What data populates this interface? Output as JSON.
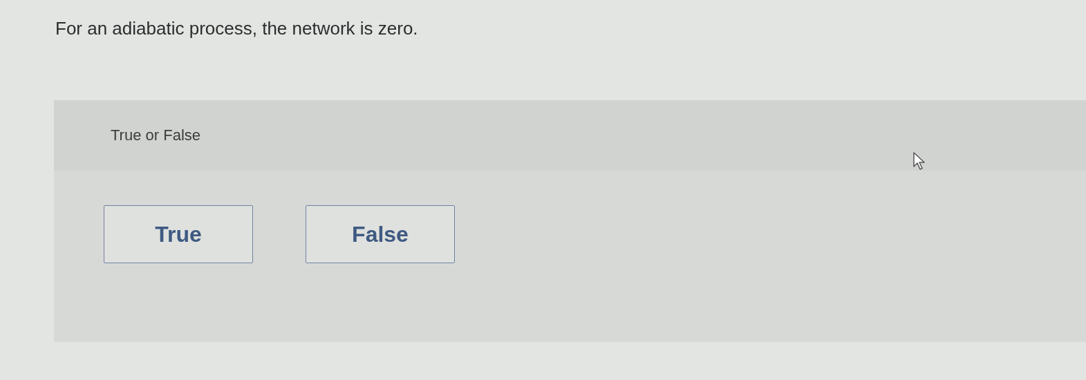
{
  "question": "For an adiabatic process, the network is zero.",
  "prompt": "True or False",
  "options": [
    {
      "label": "True",
      "selected": false
    },
    {
      "label": "False",
      "selected": false
    }
  ]
}
